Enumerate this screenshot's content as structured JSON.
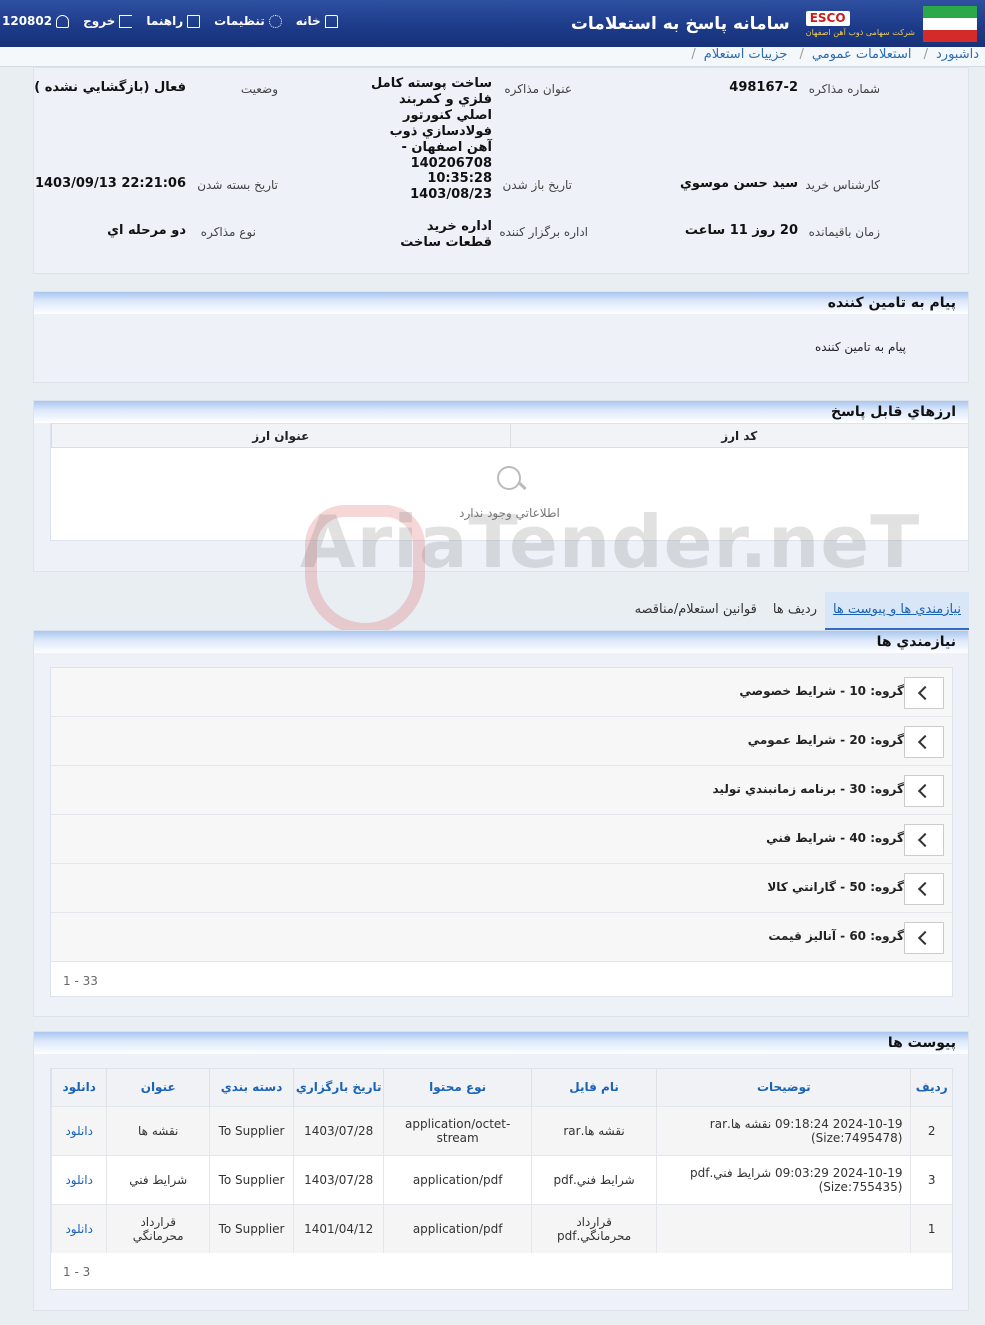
{
  "header": {
    "app_title": "سامانه پاسخ به استعلامات",
    "brand": "ESCO",
    "brand_sub": "شرکت سهامی ذوب آهن اصفهان",
    "nav": {
      "home": "خانه",
      "settings": "تنظیمات",
      "help": "راهنما",
      "logout": "خروج",
      "user_id": "120802"
    }
  },
  "breadcrumb": [
    "داشبورد",
    "استعلامات عمومي",
    "جزييات استعلام"
  ],
  "info": {
    "negotiation_number_label": "شماره مذاکره",
    "negotiation_number": "498167-2",
    "negotiation_title_label": "عنوان مذاکره",
    "negotiation_title": "ساخت پوسته کامل فلزي و کمربند اصلي کنورتور فولادسازي ذوب آهن اصفهان - 140206708",
    "status_label": "وضعيت",
    "status": "فعال (بازگشايي نشده )",
    "buyer_label": "کارشناس خريد",
    "buyer": "سيد حسن موسوي",
    "open_date_label": "تاريخ باز شدن",
    "open_time": "10:35:28",
    "open_date": "1403/08/23",
    "close_date_label": "تاريخ بسته شدن",
    "close_date": "1403/09/13 22:21:06",
    "remaining_label": "زمان باقيمانده",
    "remaining": "20 روز 11 ساعت",
    "organizer_label": "اداره برگزار کننده",
    "organizer": "اداره خريد قطعات ساخت",
    "type_label": "نوع مذاکره",
    "type": "دو مرحله اي"
  },
  "supplier_message": {
    "title": "پيام به تامين کننده",
    "body": "پيام به تامين کننده"
  },
  "currencies": {
    "title": "ارزهاي قابل پاسخ",
    "columns": [
      "کد ارز",
      "عنوان ارز"
    ],
    "empty_text": "اطلاعاتي وجود ندارد"
  },
  "tabs": [
    "نيازمندي ها و پيوست ها",
    "رديف ها",
    "قوانين استعلام/مناقصه"
  ],
  "requirements": {
    "title": "نيازمندي ها",
    "groups": [
      "گروه: 10 - شرايط خصوصي",
      "گروه: 20 - شرايط عمومي",
      "گروه: 30 - برنامه زمانبندي توليد",
      "گروه: 40 - شرايط فني",
      "گروه: 50 - گارانتي کالا",
      "گروه: 60 - آناليز قيمت"
    ],
    "pager": "1 - 33"
  },
  "attachments": {
    "title": "پيوست ها",
    "columns": [
      "رديف",
      "توضيحات",
      "نام فايل",
      "نوع محتوا",
      "تاريخ بارگزاري",
      "دسته بندي",
      "عنوان",
      "دانلود"
    ],
    "rows": [
      [
        "2",
        "2024-10-19 09:18:24 نقشه ها.rar (Size:7495478)",
        "نقشه ها.rar",
        "application/octet-stream",
        "1403/07/28",
        "To Supplier",
        "نقشه ها",
        "دانلود"
      ],
      [
        "3",
        "2024-10-19 09:03:29 شرايط فني.pdf (Size:755435)",
        "شرايط فني.pdf",
        "application/pdf",
        "1403/07/28",
        "To Supplier",
        "شرايط فني",
        "دانلود"
      ],
      [
        "1",
        "",
        "قرارداد محرمانگي.pdf",
        "application/pdf",
        "1401/04/12",
        "To Supplier",
        "قرارداد محرمانگي",
        "دانلود"
      ]
    ],
    "pager": "1 - 3"
  },
  "watermark": "AriaTender.neT"
}
